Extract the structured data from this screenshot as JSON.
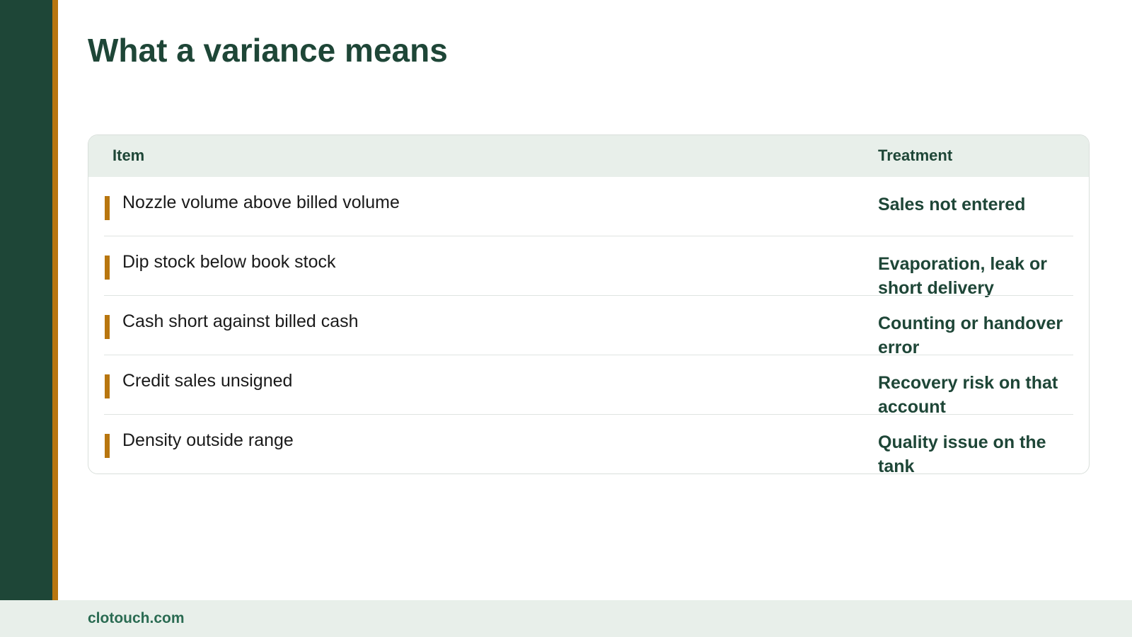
{
  "slide": {
    "title": "What a variance means"
  },
  "table": {
    "headers": {
      "item": "Item",
      "treatment": "Treatment"
    },
    "rows": [
      {
        "item": "Nozzle volume above billed volume",
        "treatment": "Sales not entered"
      },
      {
        "item": "Dip stock below book stock",
        "treatment": "Evaporation, leak or short delivery"
      },
      {
        "item": "Cash short against billed cash",
        "treatment": "Counting or handover error"
      },
      {
        "item": "Credit sales unsigned",
        "treatment": "Recovery risk on that account"
      },
      {
        "item": "Density outside range",
        "treatment": "Quality issue on the tank"
      }
    ]
  },
  "footer": {
    "site": "clotouch.com"
  },
  "colors": {
    "brand_green": "#1e4637",
    "accent_amber": "#b8760f",
    "header_tint": "#e8efea"
  }
}
